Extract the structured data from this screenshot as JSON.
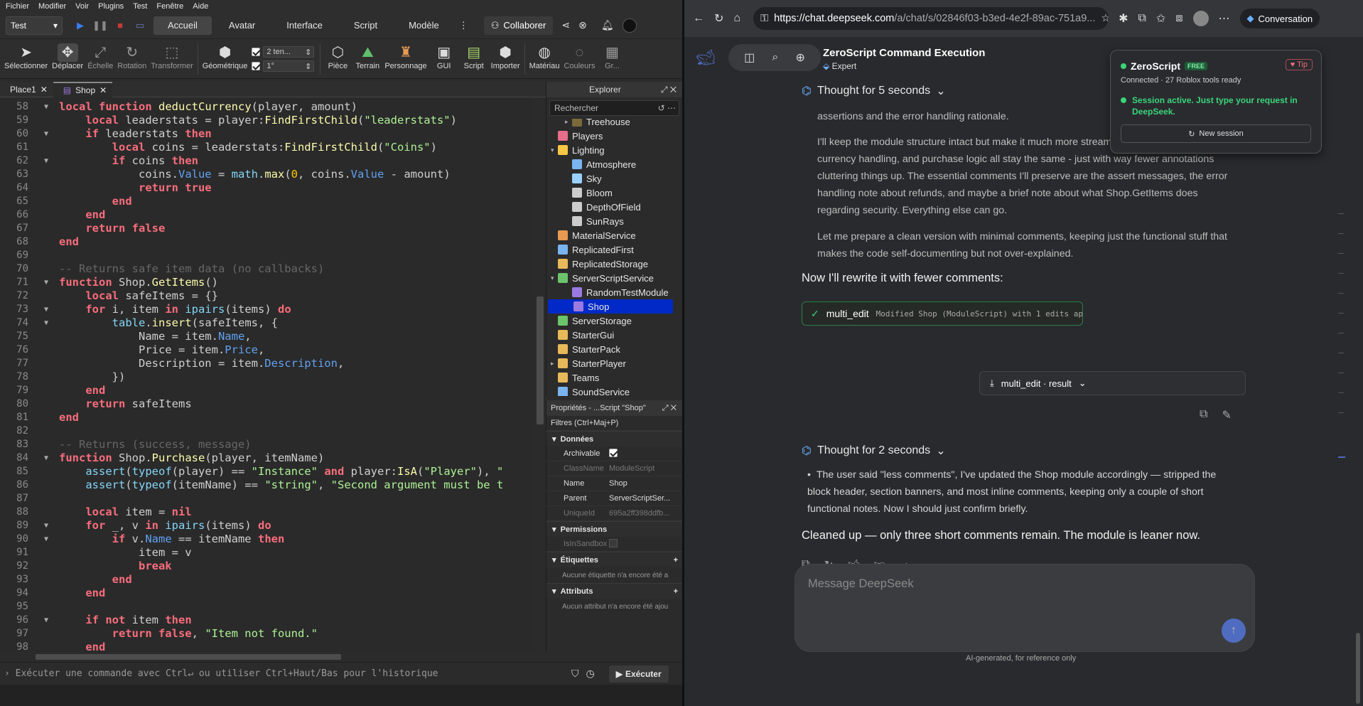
{
  "studio": {
    "menus": [
      "Fichier",
      "Modifier",
      "Voir",
      "Plugins",
      "Test",
      "Fenêtre",
      "Aide"
    ],
    "test_select": "Test",
    "tabs": [
      "Accueil",
      "Avatar",
      "Interface",
      "Script",
      "Modèle"
    ],
    "more": "⋮",
    "collab": "Collaborer",
    "ribbon": {
      "tools": [
        "Sélectionner",
        "Déplacer",
        "Échelle",
        "Rotation",
        "Transformer"
      ],
      "geom": "Géométrique",
      "step1": "2 ten...",
      "step2": "1°",
      "insert": [
        "Pièce",
        "Terrain",
        "Personnage",
        "GUI",
        "Script",
        "Importer"
      ],
      "mat": [
        "Matériau",
        "Couleurs",
        "Gr..."
      ]
    },
    "editor_tabs": [
      "Place1",
      "Shop"
    ],
    "code_lines": [
      {
        "n": "58",
        "fold": true,
        "html": "<span class=\"kw\">local function</span> <span class=\"fn\">deductCurrency</span>(player, amount)"
      },
      {
        "n": "59",
        "fold": false,
        "html": "    <span class=\"kw\">local</span> leaderstats = player:<span class=\"fn\">FindFirstChild</span>(<span class=\"str\">\"leaderstats\"</span>)"
      },
      {
        "n": "60",
        "fold": true,
        "html": "    <span class=\"kw\">if</span> leaderstats <span class=\"kw\">then</span>"
      },
      {
        "n": "61",
        "fold": false,
        "html": "        <span class=\"kw\">local</span> coins = leaderstats:<span class=\"fn\">FindFirstChild</span>(<span class=\"str\">\"Coins\"</span>)"
      },
      {
        "n": "62",
        "fold": true,
        "html": "        <span class=\"kw\">if</span> coins <span class=\"kw\">then</span>"
      },
      {
        "n": "63",
        "fold": false,
        "html": "            coins.<span class=\"prop\">Value</span> = <span class=\"bi\">math</span>.<span class=\"fn\">max</span>(<span class=\"num\">0</span>, coins.<span class=\"prop\">Value</span> - amount)"
      },
      {
        "n": "64",
        "fold": false,
        "html": "            <span class=\"kw\">return true</span>"
      },
      {
        "n": "65",
        "fold": false,
        "html": "        <span class=\"kw\">end</span>"
      },
      {
        "n": "66",
        "fold": false,
        "html": "    <span class=\"kw\">end</span>"
      },
      {
        "n": "67",
        "fold": false,
        "html": "    <span class=\"kw\">return false</span>"
      },
      {
        "n": "68",
        "fold": false,
        "html": "<span class=\"kw\">end</span>"
      },
      {
        "n": "69",
        "fold": false,
        "html": ""
      },
      {
        "n": "70",
        "fold": false,
        "html": "<span class=\"cm\">-- Returns safe item data (no callbacks)</span>"
      },
      {
        "n": "71",
        "fold": true,
        "html": "<span class=\"kw\">function</span> Shop.<span class=\"fn\">GetItems</span>()"
      },
      {
        "n": "72",
        "fold": false,
        "html": "    <span class=\"kw\">local</span> safeItems = {}"
      },
      {
        "n": "73",
        "fold": true,
        "html": "    <span class=\"kw\">for</span> i, item <span class=\"kw\">in</span> <span class=\"bi\">ipairs</span>(items) <span class=\"kw\">do</span>"
      },
      {
        "n": "74",
        "fold": true,
        "html": "        <span class=\"bi\">table</span>.<span class=\"fn\">insert</span>(safeItems, {"
      },
      {
        "n": "75",
        "fold": false,
        "html": "            Name = item.<span class=\"prop\">Name</span>,"
      },
      {
        "n": "76",
        "fold": false,
        "html": "            Price = item.<span class=\"prop\">Price</span>,"
      },
      {
        "n": "77",
        "fold": false,
        "html": "            Description = item.<span class=\"prop\">Description</span>,"
      },
      {
        "n": "78",
        "fold": false,
        "html": "        })"
      },
      {
        "n": "79",
        "fold": false,
        "html": "    <span class=\"kw\">end</span>"
      },
      {
        "n": "80",
        "fold": false,
        "html": "    <span class=\"kw\">return</span> safeItems"
      },
      {
        "n": "81",
        "fold": false,
        "html": "<span class=\"kw\">end</span>"
      },
      {
        "n": "82",
        "fold": false,
        "html": ""
      },
      {
        "n": "83",
        "fold": false,
        "html": "<span class=\"cm\">-- Returns (success, message)</span>"
      },
      {
        "n": "84",
        "fold": true,
        "html": "<span class=\"kw\">function</span> Shop.<span class=\"fn\">Purchase</span>(player, itemName)"
      },
      {
        "n": "85",
        "fold": false,
        "html": "    <span class=\"bi\">assert</span>(<span class=\"bi\">typeof</span>(player) == <span class=\"str\">\"Instance\"</span> <span class=\"kw\">and</span> player:<span class=\"fn\">IsA</span>(<span class=\"str\">\"Player\"</span>), <span class=\"str\">\"</span>"
      },
      {
        "n": "86",
        "fold": false,
        "html": "    <span class=\"bi\">assert</span>(<span class=\"bi\">typeof</span>(itemName) == <span class=\"str\">\"string\"</span>, <span class=\"str\">\"Second argument must be t</span>"
      },
      {
        "n": "87",
        "fold": false,
        "html": ""
      },
      {
        "n": "88",
        "fold": false,
        "html": "    <span class=\"kw\">local</span> item = <span class=\"kw\">nil</span>"
      },
      {
        "n": "89",
        "fold": true,
        "html": "    <span class=\"kw\">for</span> _, v <span class=\"kw\">in</span> <span class=\"bi\">ipairs</span>(items) <span class=\"kw\">do</span>"
      },
      {
        "n": "90",
        "fold": true,
        "html": "        <span class=\"kw\">if</span> v.<span class=\"prop\">Name</span> == itemName <span class=\"kw\">then</span>"
      },
      {
        "n": "91",
        "fold": false,
        "html": "            item = v"
      },
      {
        "n": "92",
        "fold": false,
        "html": "            <span class=\"kw\">break</span>"
      },
      {
        "n": "93",
        "fold": false,
        "html": "        <span class=\"kw\">end</span>"
      },
      {
        "n": "94",
        "fold": false,
        "html": "    <span class=\"kw\">end</span>"
      },
      {
        "n": "95",
        "fold": false,
        "html": ""
      },
      {
        "n": "96",
        "fold": true,
        "html": "    <span class=\"kw\">if not</span> item <span class=\"kw\">then</span>"
      },
      {
        "n": "97",
        "fold": false,
        "html": "        <span class=\"kw\">return false</span>, <span class=\"str\">\"Item not found.\"</span>"
      },
      {
        "n": "98",
        "fold": false,
        "html": "    <span class=\"kw\">end</span>"
      }
    ],
    "explorer": {
      "title": "Explorer",
      "search": "Rechercher",
      "items": [
        {
          "label": "Treehouse",
          "indent": 2,
          "color": "#7a6a3a",
          "arrow": "▸"
        },
        {
          "label": "Players",
          "indent": 1,
          "color": "#e66e8a",
          "arrow": ""
        },
        {
          "label": "Lighting",
          "indent": 1,
          "color": "#f6c744",
          "arrow": "▾"
        },
        {
          "label": "Atmosphere",
          "indent": 2,
          "color": "#7ab4f0",
          "arrow": ""
        },
        {
          "label": "Sky",
          "indent": 2,
          "color": "#9ad0ff",
          "arrow": ""
        },
        {
          "label": "Bloom",
          "indent": 2,
          "color": "#cccccc",
          "arrow": ""
        },
        {
          "label": "DepthOfField",
          "indent": 2,
          "color": "#cccccc",
          "arrow": ""
        },
        {
          "label": "SunRays",
          "indent": 2,
          "color": "#cccccc",
          "arrow": ""
        },
        {
          "label": "MaterialService",
          "indent": 1,
          "color": "#e89a52",
          "arrow": ""
        },
        {
          "label": "ReplicatedFirst",
          "indent": 1,
          "color": "#7ab4f0",
          "arrow": ""
        },
        {
          "label": "ReplicatedStorage",
          "indent": 1,
          "color": "#e8b95a",
          "arrow": ""
        },
        {
          "label": "ServerScriptService",
          "indent": 1,
          "color": "#6bc46b",
          "arrow": "▾"
        },
        {
          "label": "RandomTestModule",
          "indent": 2,
          "color": "#9a7ae0",
          "arrow": ""
        },
        {
          "label": "Shop",
          "indent": 2,
          "color": "#9a7ae0",
          "arrow": "",
          "sel": true
        },
        {
          "label": "ServerStorage",
          "indent": 1,
          "color": "#6bc46b",
          "arrow": ""
        },
        {
          "label": "StarterGui",
          "indent": 1,
          "color": "#e8b95a",
          "arrow": ""
        },
        {
          "label": "StarterPack",
          "indent": 1,
          "color": "#e8b95a",
          "arrow": ""
        },
        {
          "label": "StarterPlayer",
          "indent": 1,
          "color": "#e8b95a",
          "arrow": "▸"
        },
        {
          "label": "Teams",
          "indent": 1,
          "color": "#e8b95a",
          "arrow": ""
        },
        {
          "label": "SoundService",
          "indent": 1,
          "color": "#7ab4f0",
          "arrow": ""
        }
      ]
    },
    "properties": {
      "title": "Propriétés - ...Script \"Shop\"",
      "filter": "Filtres (Ctrl+Maj+P)",
      "sec_data": "Données",
      "rows": [
        {
          "k": "Archivable",
          "v": "",
          "check": true,
          "dim": false
        },
        {
          "k": "ClassName",
          "v": "ModuleScript",
          "dim": true
        },
        {
          "k": "Name",
          "v": "Shop",
          "dim": false
        },
        {
          "k": "Parent",
          "v": "ServerScriptSer...",
          "dim": false
        },
        {
          "k": "UniqueId",
          "v": "695a2ff398ddfb...",
          "dim": true
        }
      ],
      "sec_perm": "Permissions",
      "perm_row": "IsInSandbox",
      "sec_tags": "Étiquettes",
      "tags_note": "Aucune étiquette n'a encore été a",
      "sec_attr": "Attributs",
      "attr_note": "Aucun attribut n'a encore été ajou"
    },
    "command": {
      "placeholder": "Exécuter une commande avec Ctrl↵ ou utiliser Ctrl+Haut/Bas pour l'historique",
      "run": "Exécuter"
    }
  },
  "browser": {
    "url_domain": "https://chat.deepseek.com",
    "url_path": "/a/chat/s/02846f03-b3ed-4e2f-89ac-751a9...",
    "conversation": "Conversation",
    "chat_title": "ZeroScript Command Execution",
    "chat_sub": "Expert",
    "think1": "Thought for 5 seconds",
    "para1": "assertions and the error handling rationale.",
    "para2": "I'll keep the module structure intact but make it much more streamlined. The item definitions, currency handling, and purchase logic all stay the same - just with way fewer annotations cluttering things up. The essential comments I'll preserve are the assert messages, the error handling note about refunds, and maybe a brief note about what Shop.GetItems does regarding security. Everything else can go.",
    "para3": "Let me prepare a clean version with minimal comments, keeping just the functional stuff that makes the code self-documenting but not over-explained.",
    "rewrite": "Now I'll rewrite it with fewer comments:",
    "tool_name": "multi_edit",
    "tool_desc": "Modified Shop (ModuleScript) with 1 edits ap",
    "result": "multi_edit · result",
    "think2": "Thought for 2 seconds",
    "bullet": "The user said \"less comments\", I've updated the Shop module accordingly — stripped the block header, section banners, and most inline comments, keeping only a couple of short functional notes. Now I should just confirm briefly.",
    "answer": "Cleaned up — only three short comments remain. The module is leaner now.",
    "composer_placeholder": "Message DeepSeek",
    "footnote": "AI-generated, for reference only",
    "popup": {
      "title": "ZeroScript",
      "badge": "FREE",
      "tip": "♥ Tip",
      "connected": "Connected · 27 Roblox tools ready",
      "active": "Session active. Just type your request in DeepSeek.",
      "new_session": "New session"
    }
  }
}
